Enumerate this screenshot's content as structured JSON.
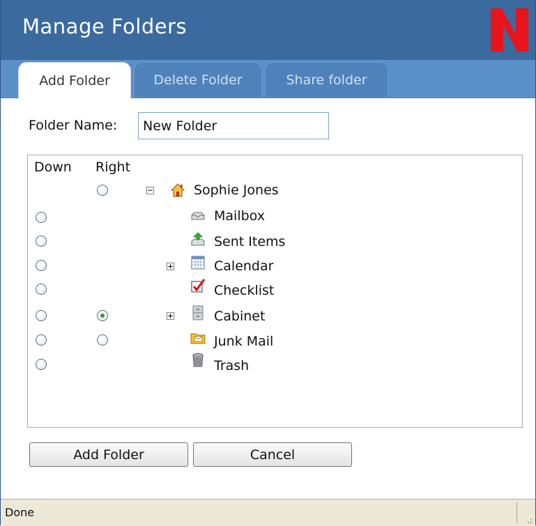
{
  "window": {
    "title": "Manage Folders",
    "logo": "N",
    "logo_color": "#e8141c"
  },
  "tabs": [
    {
      "label": "Add Folder",
      "active": true
    },
    {
      "label": "Delete Folder",
      "active": false
    },
    {
      "label": "Share folder",
      "active": false
    }
  ],
  "form": {
    "folder_name_label": "Folder Name:",
    "folder_name_value": "New Folder"
  },
  "tree": {
    "col_down": "Down",
    "col_right": "Right",
    "items": [
      {
        "label": "Sophie Jones",
        "icon": "home-icon",
        "expander": "minus",
        "down_radio": false,
        "right_radio": true,
        "right_checked": false
      },
      {
        "label": "Mailbox",
        "icon": "mailbox-icon",
        "expander": null,
        "down_radio": true,
        "right_radio": false,
        "right_checked": false
      },
      {
        "label": "Sent Items",
        "icon": "sent-items-icon",
        "expander": null,
        "down_radio": true,
        "right_radio": false,
        "right_checked": false
      },
      {
        "label": "Calendar",
        "icon": "calendar-icon",
        "expander": "plus",
        "down_radio": true,
        "right_radio": false,
        "right_checked": false
      },
      {
        "label": "Checklist",
        "icon": "checklist-icon",
        "expander": null,
        "down_radio": true,
        "right_radio": false,
        "right_checked": false
      },
      {
        "label": "Cabinet",
        "icon": "cabinet-icon",
        "expander": "plus",
        "down_radio": true,
        "right_radio": true,
        "right_checked": true
      },
      {
        "label": "Junk Mail",
        "icon": "junk-mail-icon",
        "expander": null,
        "down_radio": true,
        "right_radio": true,
        "right_checked": false
      },
      {
        "label": "Trash",
        "icon": "trash-icon",
        "expander": null,
        "down_radio": true,
        "right_radio": false,
        "right_checked": false
      }
    ]
  },
  "buttons": {
    "add_label": "Add Folder",
    "cancel_label": "Cancel"
  },
  "status": {
    "text": "Done"
  },
  "colors": {
    "title_bar": "#3a6a9e",
    "tab_bar": "#5b8fc7",
    "status_bar": "#ece9d8"
  }
}
